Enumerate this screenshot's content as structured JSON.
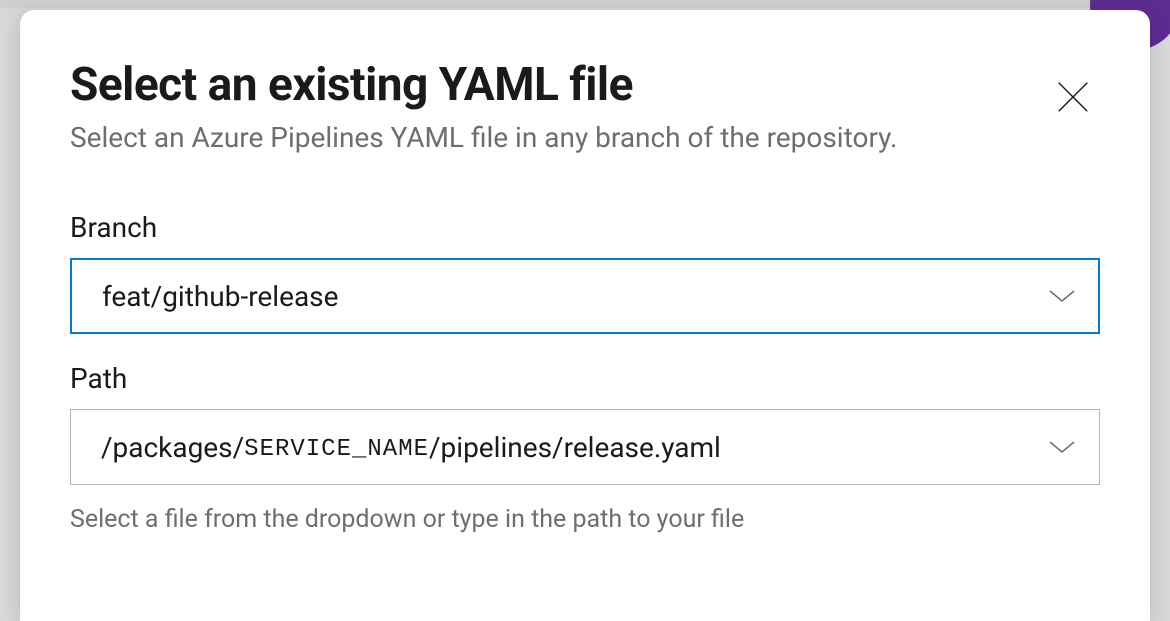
{
  "dialog": {
    "title": "Select an existing YAML file",
    "subtitle": "Select an Azure Pipelines YAML file in any branch of the repository."
  },
  "branch": {
    "label": "Branch",
    "value": "feat/github-release"
  },
  "path": {
    "label": "Path",
    "prefix": "/packages/",
    "token": "SERVICE_NAME",
    "suffix": "/pipelines/release.yaml",
    "hint": "Select a file from the dropdown or type in the path to your file"
  }
}
